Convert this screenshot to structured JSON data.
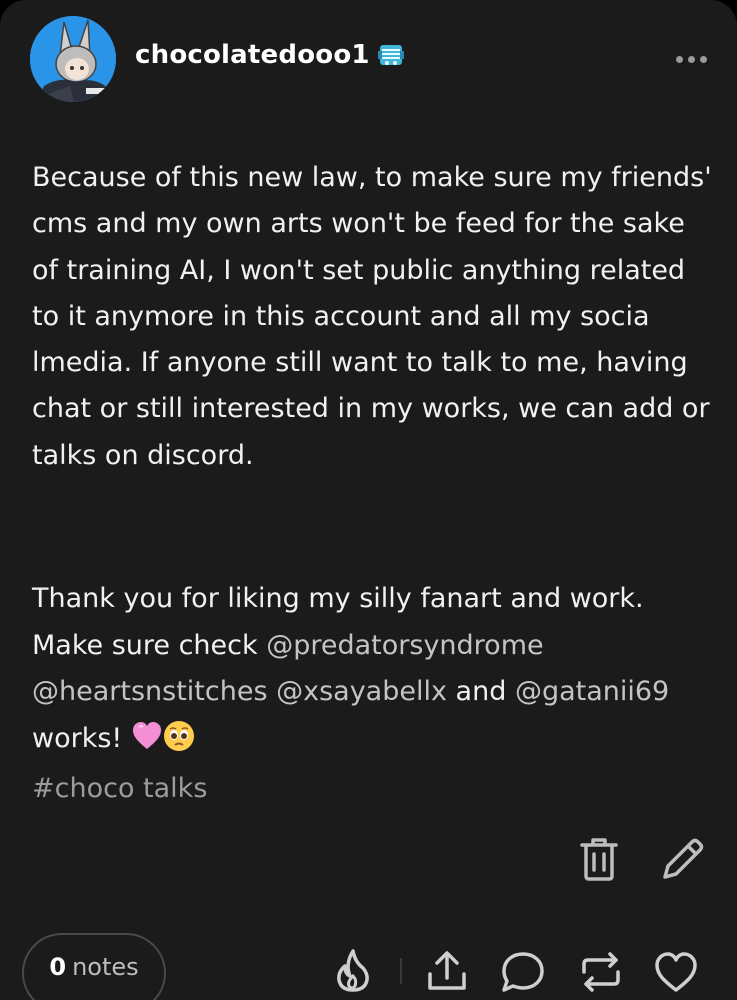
{
  "post": {
    "username": "chocolatedooo1",
    "paragraph1": "Because of this new law, to make sure my friends' cms and my own arts won't be feed for the sake of training AI, I won't set public anything related to it anymore in this account and all my socia lmedia. If anyone still want to talk to me, having chat or still interested in my works, we can add or talks on discord.",
    "p2_text1": "Thank you for liking my silly fanart and work. Make sure check ",
    "mentions": [
      "@predatorsyndrome",
      "@heartsnstitches",
      "@xsayabellx",
      "@gatanii69"
    ],
    "p2_and": " and ",
    "p2_end": "works!",
    "emojis": [
      "pink-heart-emoji",
      "pleading-face-emoji"
    ],
    "tag": "#choco talks"
  },
  "footer": {
    "notes_count": "0",
    "notes_label": "notes"
  },
  "icons": [
    "more-options-icon",
    "badge-icon",
    "delete-icon",
    "edit-icon",
    "blaze-icon",
    "share-icon",
    "reply-icon",
    "reblog-icon",
    "like-icon"
  ],
  "colors": {
    "background": "#1b1b1b",
    "text": "#f1f1f1",
    "mention": "#c4c4c4",
    "tag": "#9c9c9c",
    "avatar_bg": "#2a94e8"
  }
}
